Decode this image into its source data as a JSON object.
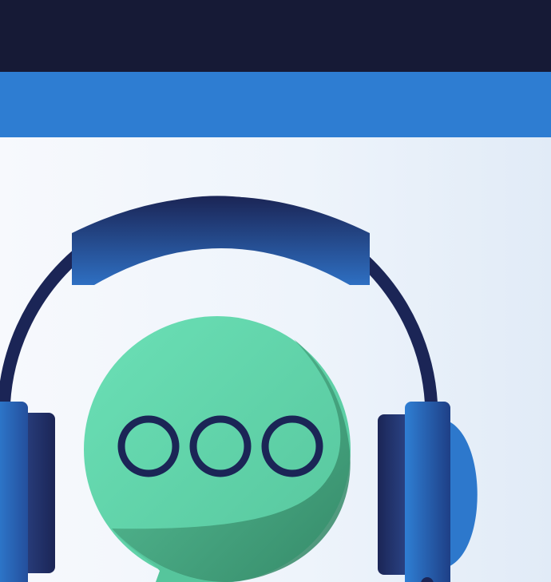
{
  "colors": {
    "top_bar": "#161a36",
    "accent_bar": "#2e7dd2",
    "background_light": "#f7f9fd",
    "background_dark": "#e1ebf7",
    "headphone_dark": "#1b2556",
    "headphone_blue": "#2f7fd4",
    "bubble_green": "#66dbb0",
    "bubble_shadow": "#3e9a76",
    "dot_ring": "#1b2556"
  },
  "icons": {
    "illustration": "headset-support-icon",
    "bubble": "chat-bubble-icon",
    "dots": "typing-dots-icon"
  }
}
